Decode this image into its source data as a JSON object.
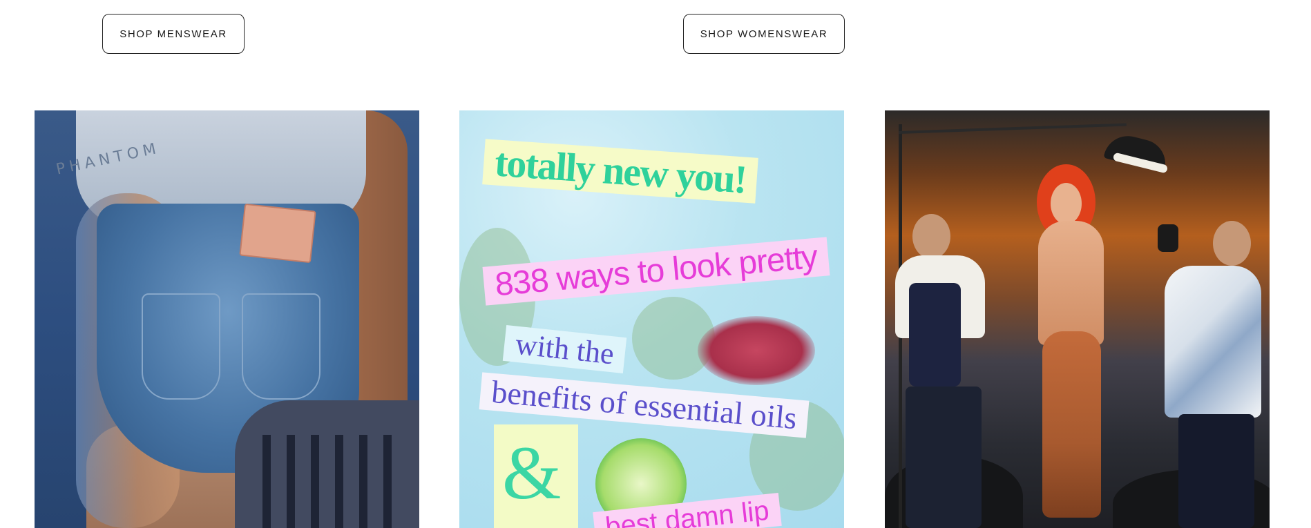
{
  "buttons": {
    "menswear": "SHOP MENSWEAR",
    "womenswear": "SHOP WOMENSWEAR"
  },
  "tiles": {
    "denim": {
      "brand_text": "PHANTOM"
    },
    "collage": {
      "line1": "totally new you!",
      "line2": "838 ways to look pretty",
      "line3": "with the",
      "line4": "benefits of essential oils",
      "line5": "&",
      "line6": "best damn lip"
    }
  },
  "colors": {
    "button_border": "#222222",
    "collage_green": "#2fd19b",
    "collage_pink": "#e63cd8",
    "collage_violet": "#5a4fcb"
  }
}
